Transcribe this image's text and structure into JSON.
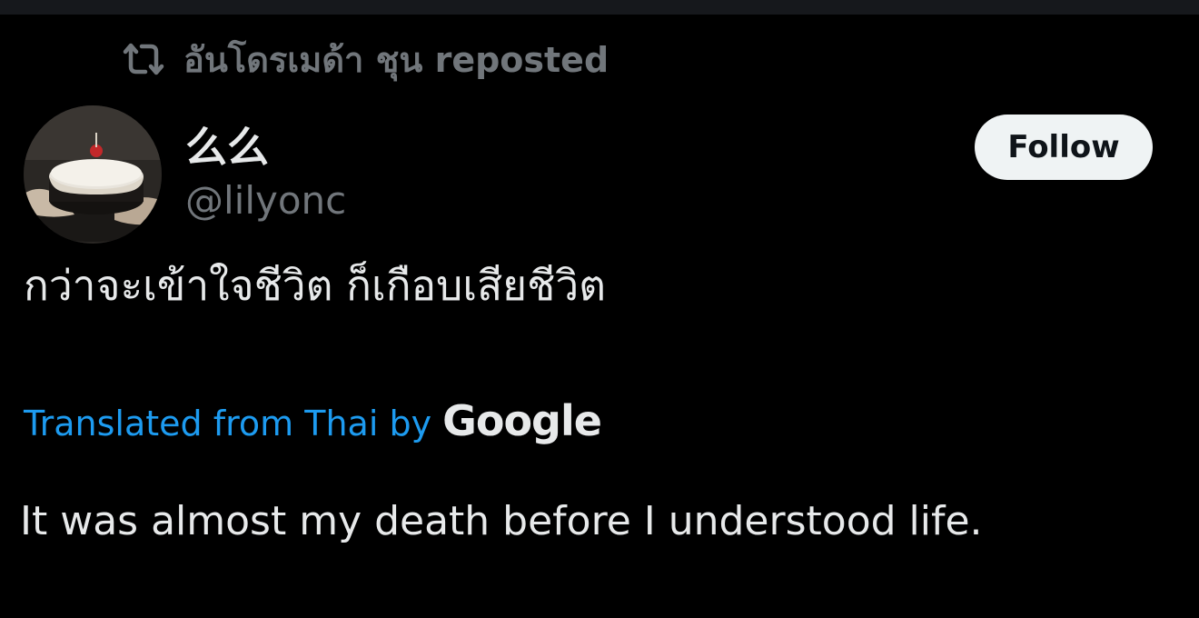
{
  "repost": {
    "icon": "repost-icon",
    "text": "อันโดรเมด้า ชุน reposted"
  },
  "author": {
    "avatar_icon": "avatar-cake-photo",
    "display_name": "么么",
    "handle": "@lilyonc"
  },
  "follow_button": {
    "label": "Follow"
  },
  "tweet": {
    "text": "กว่าจะเข้าใจชีวิต ก็เกือบเสียชีวิต",
    "translation_label": "Translated from Thai by",
    "translation_provider": "Google",
    "translated_text": "It was almost my death before I understood life."
  },
  "colors": {
    "background": "#000000",
    "primary_text": "#e7e9ea",
    "secondary_text": "#71767b",
    "link": "#1d9bf0",
    "follow_bg": "#eff3f4",
    "follow_text": "#0f1419"
  }
}
